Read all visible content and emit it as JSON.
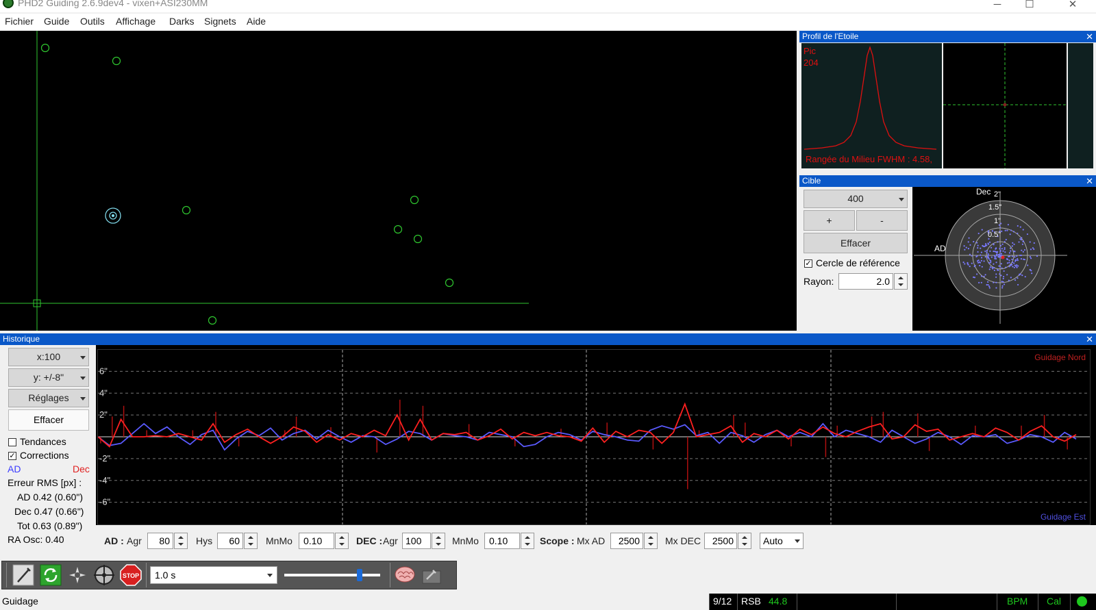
{
  "window": {
    "title": "PHD2 Guiding 2.6.9dev4 - vixen+ASI230MM",
    "minimize": "─",
    "maximize": "☐",
    "close": "✕"
  },
  "menu": [
    "Fichier",
    "Guide",
    "Outils",
    "Affichage",
    "Darks",
    "Signets",
    "Aide"
  ],
  "profile": {
    "title": "Profil de l'Etoile",
    "close": "✕",
    "peak_label": "Pic",
    "peak_value": "204",
    "fwhm_text": "Rangée du Milieu FWHM : 4.58,"
  },
  "target": {
    "title": "Cible",
    "close": "✕",
    "zoom_value": "400",
    "plus_label": "+",
    "minus_label": "-",
    "clear_label": "Effacer",
    "ref_circle_label": "Cercle de référence",
    "ref_circle_checked": true,
    "radius_label": "Rayon:",
    "radius_value": "2.0",
    "axis_dec": "Dec",
    "axis_ad": "AD",
    "ring_labels": [
      "2\"",
      "1.5\"",
      "1\"",
      "0.5\""
    ]
  },
  "history": {
    "title": "Historique",
    "close": "✕",
    "x_scale": "x:100",
    "y_scale": "y: +/-8\"",
    "settings_label": "Réglages",
    "clear_label": "Effacer",
    "trends_label": "Tendances",
    "trends_checked": false,
    "corrections_label": "Corrections",
    "corrections_checked": true,
    "legend_ad": "AD",
    "legend_dec": "Dec",
    "rms_title": "Erreur RMS [px] :",
    "rms_ad": "AD 0.42 (0.60\")",
    "rms_dec": "Dec 0.47 (0.66\")",
    "rms_tot": "Tot 0.63 (0.89\")",
    "ra_osc": "RA Osc: 0.40",
    "y_labels": [
      "6\"",
      "4\"",
      "2\"",
      "-2\"",
      "-4\"",
      "-6\""
    ],
    "guide_north": "Guidage Nord",
    "guide_east": "Guidage Est",
    "colors": {
      "ad": "#5a5aff",
      "dec": "#ff2020",
      "corr_dec": "#b01010"
    }
  },
  "controls": {
    "ad_label": "AD :",
    "ad_agr_label": "Agr",
    "ad_agr_value": "80",
    "hys_label": "Hys",
    "hys_value": "60",
    "ad_mnmo_label": "MnMo",
    "ad_mnmo_value": "0.10",
    "dec_label": "DEC :",
    "dec_agr_label": "Agr",
    "dec_agr_value": "100",
    "dec_mnmo_label": "MnMo",
    "dec_mnmo_value": "0.10",
    "scope_label": "Scope :",
    "mx_ad_label": "Mx AD",
    "mx_ad_value": "2500",
    "mx_dec_label": "Mx DEC",
    "mx_dec_value": "2500",
    "mode_value": "Auto"
  },
  "toolbar": {
    "exposure_value": "1.0 s",
    "slider_level": 0.8,
    "icons": [
      "loupe-icon",
      "loop-icon",
      "auto-select-star-icon",
      "guide-crosshair-icon",
      "stop-icon",
      "brain-icon",
      "tools-icon"
    ],
    "stop_label": "STOP"
  },
  "status": {
    "mode": "Guidage",
    "frames": "9/12",
    "snr_label": "RSB",
    "snr_value": "44.8",
    "bpm": "BPM",
    "cal": "Cal",
    "green": "#1ec81e"
  },
  "chart_data": {
    "type": "line",
    "ylim": [
      -8,
      8
    ],
    "series": [
      {
        "name": "AD",
        "values": [
          0.0,
          -0.8,
          -0.6,
          0.3,
          1.2,
          0.3,
          0.9,
          0.0,
          -0.7,
          0.2,
          0.6,
          -1.2,
          -0.2,
          0.5,
          0.1,
          0.8,
          -0.3,
          0.3,
          0.6,
          -0.2,
          0.6,
          0.0,
          -0.5,
          0.1,
          0.0,
          -0.7,
          -0.2,
          0.5,
          0.3,
          -0.3,
          0.3,
          0.1,
          0.0,
          -0.3,
          0.4,
          0.2,
          0.0,
          -0.9,
          -0.7,
          0.0,
          0.4,
          0.2,
          -0.3,
          0.5,
          0.2,
          0.0,
          -0.3,
          -0.4,
          0.6,
          1.0,
          0.7,
          1.1,
          0.1,
          0.4,
          -0.6,
          0.4,
          0.1,
          -0.5,
          0.2,
          0.6,
          0.0,
          0.4,
          0.0,
          1.2,
          0.0,
          0.6,
          0.3,
          0.0,
          -0.5,
          0.6,
          0.0,
          -0.6,
          -0.2,
          0.4,
          0.0,
          -0.7,
          0.1,
          0.0,
          0.2,
          -0.6,
          -0.3,
          0.2,
          0.0,
          -0.5,
          0.4,
          -0.2
        ]
      },
      {
        "name": "Dec",
        "values": [
          0.0,
          -0.9,
          1.6,
          0.0,
          0.0,
          0.1,
          0.0,
          0.3,
          0.0,
          -0.3,
          1.2,
          -0.5,
          0.2,
          0.7,
          0.0,
          -0.6,
          0.0,
          0.9,
          0.5,
          -0.5,
          0.2,
          -0.3,
          0.3,
          0.0,
          0.6,
          0.1,
          2.0,
          -0.3,
          1.6,
          -0.3,
          0.3,
          0.2,
          0.4,
          -0.3,
          0.1,
          0.7,
          -0.2,
          0.4,
          0.1,
          0.4,
          0.1,
          0.0,
          -0.4,
          0.8,
          -0.5,
          0.5,
          0.0,
          0.6,
          0.4,
          -0.6,
          0.4,
          3.0,
          0.0,
          0.2,
          0.4,
          1.0,
          -0.5,
          0.3,
          0.0,
          0.6,
          -0.2,
          0.7,
          0.2,
          0.9,
          0.3,
          0.0,
          0.5,
          0.9,
          1.2,
          -0.2,
          0.0,
          1.1,
          0.5,
          0.7,
          -0.3,
          0.0,
          0.3,
          0.0,
          0.8,
          0.4,
          -0.3,
          0.5,
          1.0,
          0.0,
          -0.4,
          0.2
        ]
      }
    ],
    "y_axis_labels": [
      "6\"",
      "4\"",
      "2\"",
      "-2\"",
      "-4\"",
      "-6\""
    ]
  }
}
